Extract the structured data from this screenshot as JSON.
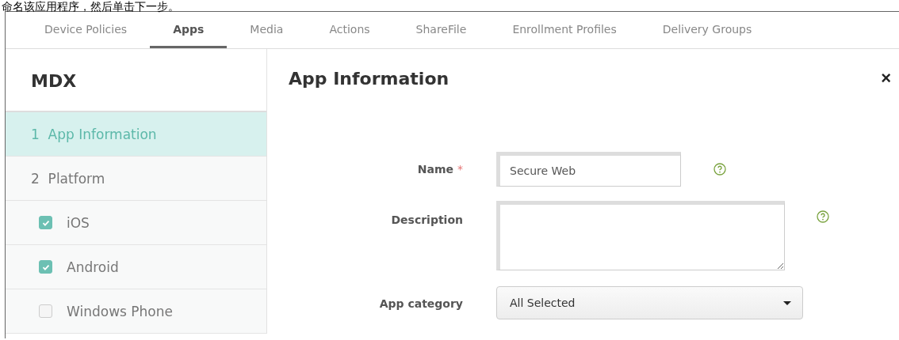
{
  "caption": "命名该应用程序，然后单击下一步。",
  "tabs": [
    {
      "label": "Device Policies",
      "selected": false
    },
    {
      "label": "Apps",
      "selected": true
    },
    {
      "label": "Media",
      "selected": false
    },
    {
      "label": "Actions",
      "selected": false
    },
    {
      "label": "ShareFile",
      "selected": false
    },
    {
      "label": "Enrollment Profiles",
      "selected": false
    },
    {
      "label": "Delivery Groups",
      "selected": false
    }
  ],
  "sidebar": {
    "title": "MDX",
    "items": [
      {
        "kind": "step",
        "number": "1",
        "label": "App Information",
        "selected": true
      },
      {
        "kind": "step",
        "number": "2",
        "label": "Platform",
        "selected": false
      },
      {
        "kind": "platform",
        "label": "iOS",
        "checked": true
      },
      {
        "kind": "platform",
        "label": "Android",
        "checked": true
      },
      {
        "kind": "platform",
        "label": "Windows Phone",
        "checked": false
      }
    ]
  },
  "panel": {
    "title": "App Information",
    "close": "×",
    "fields": [
      {
        "kind": "text",
        "label": "Name",
        "required_mark": "*",
        "value": "Secure Web",
        "help": true
      },
      {
        "kind": "textarea",
        "label": "Description",
        "help": true
      },
      {
        "kind": "select",
        "label": "App category",
        "value": "All Selected",
        "help": false
      }
    ]
  }
}
